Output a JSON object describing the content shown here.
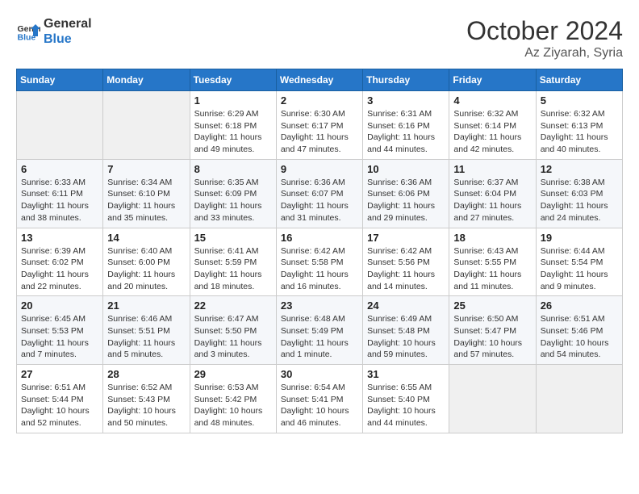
{
  "header": {
    "logo_line1": "General",
    "logo_line2": "Blue",
    "month": "October 2024",
    "location": "Az Ziyarah, Syria"
  },
  "weekdays": [
    "Sunday",
    "Monday",
    "Tuesday",
    "Wednesday",
    "Thursday",
    "Friday",
    "Saturday"
  ],
  "weeks": [
    [
      {
        "day": "",
        "info": ""
      },
      {
        "day": "",
        "info": ""
      },
      {
        "day": "1",
        "info": "Sunrise: 6:29 AM\nSunset: 6:18 PM\nDaylight: 11 hours and 49 minutes."
      },
      {
        "day": "2",
        "info": "Sunrise: 6:30 AM\nSunset: 6:17 PM\nDaylight: 11 hours and 47 minutes."
      },
      {
        "day": "3",
        "info": "Sunrise: 6:31 AM\nSunset: 6:16 PM\nDaylight: 11 hours and 44 minutes."
      },
      {
        "day": "4",
        "info": "Sunrise: 6:32 AM\nSunset: 6:14 PM\nDaylight: 11 hours and 42 minutes."
      },
      {
        "day": "5",
        "info": "Sunrise: 6:32 AM\nSunset: 6:13 PM\nDaylight: 11 hours and 40 minutes."
      }
    ],
    [
      {
        "day": "6",
        "info": "Sunrise: 6:33 AM\nSunset: 6:11 PM\nDaylight: 11 hours and 38 minutes."
      },
      {
        "day": "7",
        "info": "Sunrise: 6:34 AM\nSunset: 6:10 PM\nDaylight: 11 hours and 35 minutes."
      },
      {
        "day": "8",
        "info": "Sunrise: 6:35 AM\nSunset: 6:09 PM\nDaylight: 11 hours and 33 minutes."
      },
      {
        "day": "9",
        "info": "Sunrise: 6:36 AM\nSunset: 6:07 PM\nDaylight: 11 hours and 31 minutes."
      },
      {
        "day": "10",
        "info": "Sunrise: 6:36 AM\nSunset: 6:06 PM\nDaylight: 11 hours and 29 minutes."
      },
      {
        "day": "11",
        "info": "Sunrise: 6:37 AM\nSunset: 6:04 PM\nDaylight: 11 hours and 27 minutes."
      },
      {
        "day": "12",
        "info": "Sunrise: 6:38 AM\nSunset: 6:03 PM\nDaylight: 11 hours and 24 minutes."
      }
    ],
    [
      {
        "day": "13",
        "info": "Sunrise: 6:39 AM\nSunset: 6:02 PM\nDaylight: 11 hours and 22 minutes."
      },
      {
        "day": "14",
        "info": "Sunrise: 6:40 AM\nSunset: 6:00 PM\nDaylight: 11 hours and 20 minutes."
      },
      {
        "day": "15",
        "info": "Sunrise: 6:41 AM\nSunset: 5:59 PM\nDaylight: 11 hours and 18 minutes."
      },
      {
        "day": "16",
        "info": "Sunrise: 6:42 AM\nSunset: 5:58 PM\nDaylight: 11 hours and 16 minutes."
      },
      {
        "day": "17",
        "info": "Sunrise: 6:42 AM\nSunset: 5:56 PM\nDaylight: 11 hours and 14 minutes."
      },
      {
        "day": "18",
        "info": "Sunrise: 6:43 AM\nSunset: 5:55 PM\nDaylight: 11 hours and 11 minutes."
      },
      {
        "day": "19",
        "info": "Sunrise: 6:44 AM\nSunset: 5:54 PM\nDaylight: 11 hours and 9 minutes."
      }
    ],
    [
      {
        "day": "20",
        "info": "Sunrise: 6:45 AM\nSunset: 5:53 PM\nDaylight: 11 hours and 7 minutes."
      },
      {
        "day": "21",
        "info": "Sunrise: 6:46 AM\nSunset: 5:51 PM\nDaylight: 11 hours and 5 minutes."
      },
      {
        "day": "22",
        "info": "Sunrise: 6:47 AM\nSunset: 5:50 PM\nDaylight: 11 hours and 3 minutes."
      },
      {
        "day": "23",
        "info": "Sunrise: 6:48 AM\nSunset: 5:49 PM\nDaylight: 11 hours and 1 minute."
      },
      {
        "day": "24",
        "info": "Sunrise: 6:49 AM\nSunset: 5:48 PM\nDaylight: 10 hours and 59 minutes."
      },
      {
        "day": "25",
        "info": "Sunrise: 6:50 AM\nSunset: 5:47 PM\nDaylight: 10 hours and 57 minutes."
      },
      {
        "day": "26",
        "info": "Sunrise: 6:51 AM\nSunset: 5:46 PM\nDaylight: 10 hours and 54 minutes."
      }
    ],
    [
      {
        "day": "27",
        "info": "Sunrise: 6:51 AM\nSunset: 5:44 PM\nDaylight: 10 hours and 52 minutes."
      },
      {
        "day": "28",
        "info": "Sunrise: 6:52 AM\nSunset: 5:43 PM\nDaylight: 10 hours and 50 minutes."
      },
      {
        "day": "29",
        "info": "Sunrise: 6:53 AM\nSunset: 5:42 PM\nDaylight: 10 hours and 48 minutes."
      },
      {
        "day": "30",
        "info": "Sunrise: 6:54 AM\nSunset: 5:41 PM\nDaylight: 10 hours and 46 minutes."
      },
      {
        "day": "31",
        "info": "Sunrise: 6:55 AM\nSunset: 5:40 PM\nDaylight: 10 hours and 44 minutes."
      },
      {
        "day": "",
        "info": ""
      },
      {
        "day": "",
        "info": ""
      }
    ]
  ]
}
